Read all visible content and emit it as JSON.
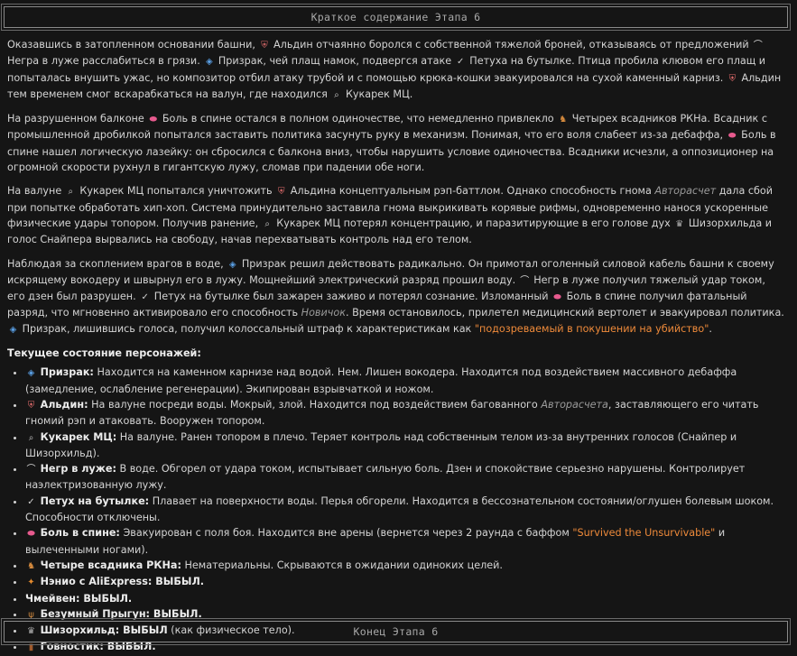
{
  "header": {
    "title": "Краткое содержание Этапа 6"
  },
  "footer": {
    "title": "Конец Этапа 6"
  },
  "p1": {
    "t1": "Оказавшись в затопленном основании башни, ",
    "aldin": "Альдин",
    "t2": " отчаянно боролся с собственной тяжелой броней, отказываясь от предложений ",
    "negr": "Негра в луже",
    "t3": " расслабиться в грязи. ",
    "prizrak": "Призрак",
    "t4": ", чей плащ намок, подвергся атаке ",
    "petukh": "Петуха на бутылке",
    "t5": ". Птица пробила клювом его плащ и попыталась внушить ужас, но композитор отбил атаку трубой и с помощью крюка-кошки эвакуировался на сухой каменный карниз. ",
    "aldin2": "Альдин",
    "t6": " тем временем смог вскарабкаться на валун, где находился ",
    "kukarek": "Кукарек МЦ",
    "t7": "."
  },
  "p2": {
    "t1": "На разрушенном балконе ",
    "bol": "Боль в спине",
    "t2": " остался в полном одиночестве, что немедленно привлекло ",
    "horsemen": "Четырех всадников РКНа",
    "t3": ". Всадник с промышленной дробилкой попытался заставить политика засунуть руку в механизм. Понимая, что его воля слабеет из-за дебаффа, ",
    "bol2": "Боль в спине",
    "t4": " нашел логическую лазейку: он сбросился с балкона вниз, чтобы нарушить условие одиночества. Всадники исчезли, а оппозиционер на огромной скорости рухнул в гигантскую лужу, сломав при падении обе ноги."
  },
  "p3": {
    "t1": "На валуне ",
    "kukarek": "Кукарек МЦ",
    "t2": " попытался уничтожить ",
    "aldin": "Альдина",
    "t3": " концептуальным рэп-баттлом. Однако способность гнома ",
    "avtoraschet": "Авторасчет",
    "t4": " дала сбой при попытке обработать хип-хоп. Система принудительно заставила гнома выкрикивать корявые рифмы, одновременно нанося ускоренные физические удары топором. Получив ранение, ",
    "kukarek2": "Кукарек МЦ",
    "t5": " потерял концентрацию, и паразитирующие в его голове дух ",
    "shizo": "Шизорхильда",
    "t6": " и голос Снайпера вырвались на свободу, начав перехватывать контроль над его телом."
  },
  "p4": {
    "t1": "Наблюдая за скоплением врагов в воде, ",
    "prizrak": "Призрак",
    "t2": " решил действовать радикально. Он примотал оголенный силовой кабель башни к своему искрящему вокодеру и швырнул его в лужу. Мощнейший электрический разряд прошил воду. ",
    "negr": "Негр в луже",
    "t3": " получил тяжелый удар током, его дзен был разрушен. ",
    "petukh": "Петух на бутылке",
    "t4": " был зажарен заживо и потерял сознание. Изломанный ",
    "bol": "Боль в спине",
    "t5": " получил фатальный разряд, что мгновенно активировало его способность ",
    "novichok": "Новичок",
    "t6": ". Время остановилось, прилетел медицинский вертолет и эвакуировал политика. ",
    "prizrak2": "Призрак",
    "t7": ", лишившись голоса, получил колоссальный штраф к характеристикам как ",
    "quote": "\"подозреваемый в покушении на убийство\"",
    "t8": "."
  },
  "status": {
    "heading": "Текущее состояние персонажей:",
    "prizrak": {
      "name": "Призрак:",
      "text": " Находится на каменном карнизе над водой. Нем. Лишен вокодера. Находится под воздействием массивного дебаффа (замедление, ослабление регенерации). Экипирован взрывчаткой и ножом."
    },
    "aldin": {
      "name": "Альдин:",
      "t1": " На валуне посреди воды. Мокрый, злой. Находится под воздействием багованного ",
      "em": "Авторасчета",
      "t2": ", заставляющего его читать гномий рэп и атаковать. Вооружен топором."
    },
    "kukarek": {
      "name": "Кукарек МЦ:",
      "text": " На валуне. Ранен топором в плечо. Теряет контроль над собственным телом из-за внутренних голосов (Снайпер и Шизорхильд)."
    },
    "negr": {
      "name": "Негр в луже:",
      "text": " В воде. Обгорел от удара током, испытывает сильную боль. Дзен и спокойствие серьезно нарушены. Контролирует наэлектризованную лужу."
    },
    "petukh": {
      "name": "Петух на бутылке:",
      "text": " Плавает на поверхности воды. Перья обгорели. Находится в бессознательном состоянии/оглушен болевым шоком. Способности отключены."
    },
    "bol": {
      "name": "Боль в спине:",
      "t1": " Эвакуирован с поля боя. Находится вне арены (вернется через 2 раунда с баффом ",
      "orange": "\"Survived the Unsurvivable\"",
      "t2": " и вылеченными ногами)."
    },
    "horsemen": {
      "name": "Четыре всадника РКНа:",
      "text": " Нематериальны. Скрываются в ожидании одиноких целей."
    },
    "nenio": {
      "name": "Нэнио с AliExpress: ВЫБЫЛ."
    },
    "chmeiven": {
      "name": "Чмейвен: ВЫБЫЛ."
    },
    "prygun": {
      "name": "Безумный Прыгун: ВЫБЫЛ."
    },
    "shizo": {
      "name": "Шизорхильд: ВЫБЫЛ",
      "text": " (как физическое тело)."
    },
    "govnostik": {
      "name": "Говностик: ВЫБЫЛ."
    }
  },
  "icons": {
    "shield": "⛨",
    "ghost": "◈",
    "bird": "✓",
    "mic": "⌕",
    "sink": "⌒",
    "pill": "⬬",
    "horse": "♞",
    "fox": "✦",
    "deer": "ψ",
    "wolf": "♛",
    "door": "▮"
  }
}
